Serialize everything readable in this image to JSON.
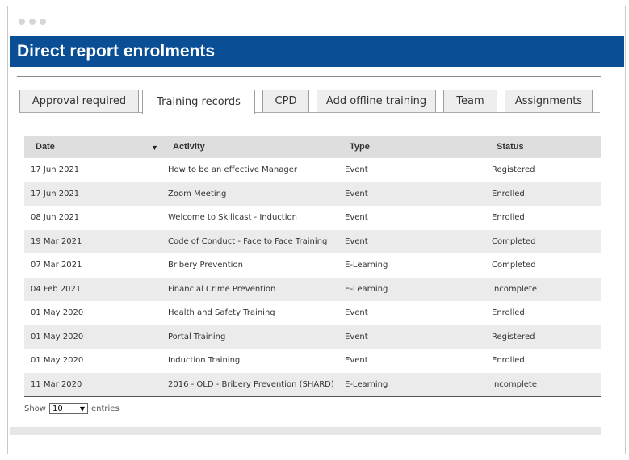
{
  "page": {
    "title": "Direct report enrolments"
  },
  "tabs": [
    {
      "label": "Approval required"
    },
    {
      "label": "Training records"
    },
    {
      "label": "CPD"
    },
    {
      "label": "Add offline training"
    },
    {
      "label": "Team"
    },
    {
      "label": "Assignments"
    }
  ],
  "active_tab": "Training records",
  "table": {
    "headers": {
      "date": "Date",
      "activity": "Activity",
      "type": "Type",
      "status": "Status"
    },
    "sort_indicator": "▼",
    "rows": [
      {
        "date": "17 Jun 2021",
        "activity": "How to be an effective Manager",
        "type": "Event",
        "status": "Registered"
      },
      {
        "date": "17 Jun 2021",
        "activity": "Zoom Meeting",
        "type": "Event",
        "status": "Enrolled"
      },
      {
        "date": "08 Jun 2021",
        "activity": "Welcome to Skillcast - Induction",
        "type": "Event",
        "status": "Enrolled"
      },
      {
        "date": "19 Mar 2021",
        "activity": "Code of Conduct - Face to Face Training",
        "type": "Event",
        "status": "Completed"
      },
      {
        "date": "07 Mar 2021",
        "activity": "Bribery Prevention",
        "type": "E-Learning",
        "status": "Completed"
      },
      {
        "date": "04 Feb 2021",
        "activity": "Financial Crime Prevention",
        "type": "E-Learning",
        "status": "Incomplete"
      },
      {
        "date": "01 May 2020",
        "activity": "Health and Safety Training",
        "type": "Event",
        "status": "Enrolled"
      },
      {
        "date": "01 May 2020",
        "activity": "Portal Training",
        "type": "Event",
        "status": "Registered"
      },
      {
        "date": "01 May 2020",
        "activity": "Induction Training",
        "type": "Event",
        "status": "Enrolled"
      },
      {
        "date": "11 Mar 2020",
        "activity": "2016 - OLD - Bribery Prevention (SHARD)",
        "type": "E-Learning",
        "status": "Incomplete"
      }
    ]
  },
  "pagination": {
    "show_label": "Show",
    "entries_value": "10",
    "entries_label": "entries"
  },
  "colors": {
    "title_bar": "#0a4e96",
    "row_alt": "#ebebeb",
    "header_bg": "#dedede"
  }
}
